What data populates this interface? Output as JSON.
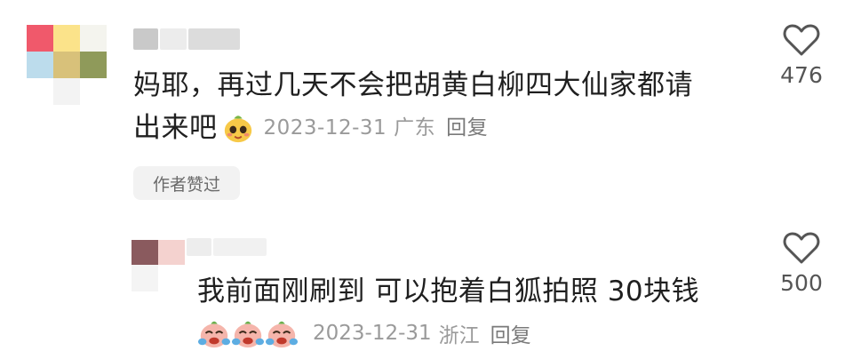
{
  "comments": [
    {
      "text_line1": "妈耶，再过几天不会把胡黄白柳四大仙家都请",
      "text_line2": "出来吧",
      "date": "2023-12-31",
      "location": "广东",
      "reply_label": "回复",
      "badge": "作者赞过",
      "like_count": "476",
      "emoji": "smiling-chick-emoji"
    },
    {
      "text": "我前面刚刷到 可以抱着白狐拍照 30块钱",
      "date": "2023-12-31",
      "location": "浙江",
      "reply_label": "回复",
      "like_count": "500",
      "emoji": "crying-laughing-emoji"
    }
  ],
  "colors": {
    "text": "#1f1f1f",
    "meta": "#9a9a9a",
    "badge_bg": "#f2f2f2",
    "heart_stroke": "#555555"
  }
}
